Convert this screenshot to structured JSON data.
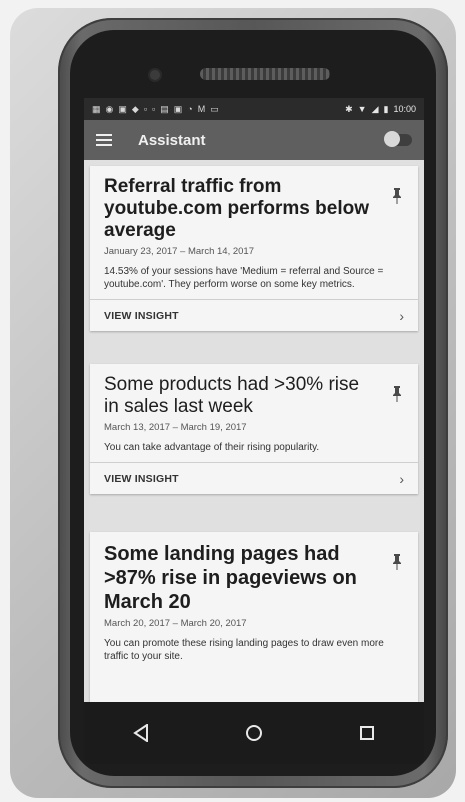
{
  "status_bar": {
    "left_icons": [
      "▦",
      "◉",
      "▣",
      "◆",
      "▫",
      "▫",
      "▤",
      "▣",
      "◔",
      "M",
      "▭"
    ],
    "right_icons": [
      "✱",
      "▼",
      "◢",
      "▮"
    ],
    "time": "10:00"
  },
  "app_bar": {
    "menu_icon": "menu-icon",
    "title": "Assistant",
    "toggle_icon": "toggle-switch-icon"
  },
  "cards": [
    {
      "title": "Referral traffic from youtube.com performs below average",
      "date_range": "January 23, 2017 – March 14, 2017",
      "description": "14.53% of your sessions have 'Medium = referral and Source = youtube.com'. They perform worse on some key metrics.",
      "action_label": "VIEW INSIGHT",
      "pin_icon": "pin-icon",
      "chevron_icon": "chevron-right-icon"
    },
    {
      "title": "Some products had >30% rise in sales last week",
      "date_range": "March 13, 2017 – March 19, 2017",
      "description": "You can take advantage of their rising popularity.",
      "action_label": "VIEW INSIGHT",
      "pin_icon": "pin-icon",
      "chevron_icon": "chevron-right-icon"
    },
    {
      "title": "Some landing pages had >87% rise in pageviews on March 20",
      "date_range": "March 20, 2017 – March 20, 2017",
      "description": "You can promote these rising landing pages to draw even more traffic to your site.",
      "pin_icon": "pin-icon"
    }
  ],
  "nav_bar": {
    "back_icon": "back-triangle-icon",
    "home_icon": "home-circle-icon",
    "recents_icon": "recents-square-icon"
  }
}
